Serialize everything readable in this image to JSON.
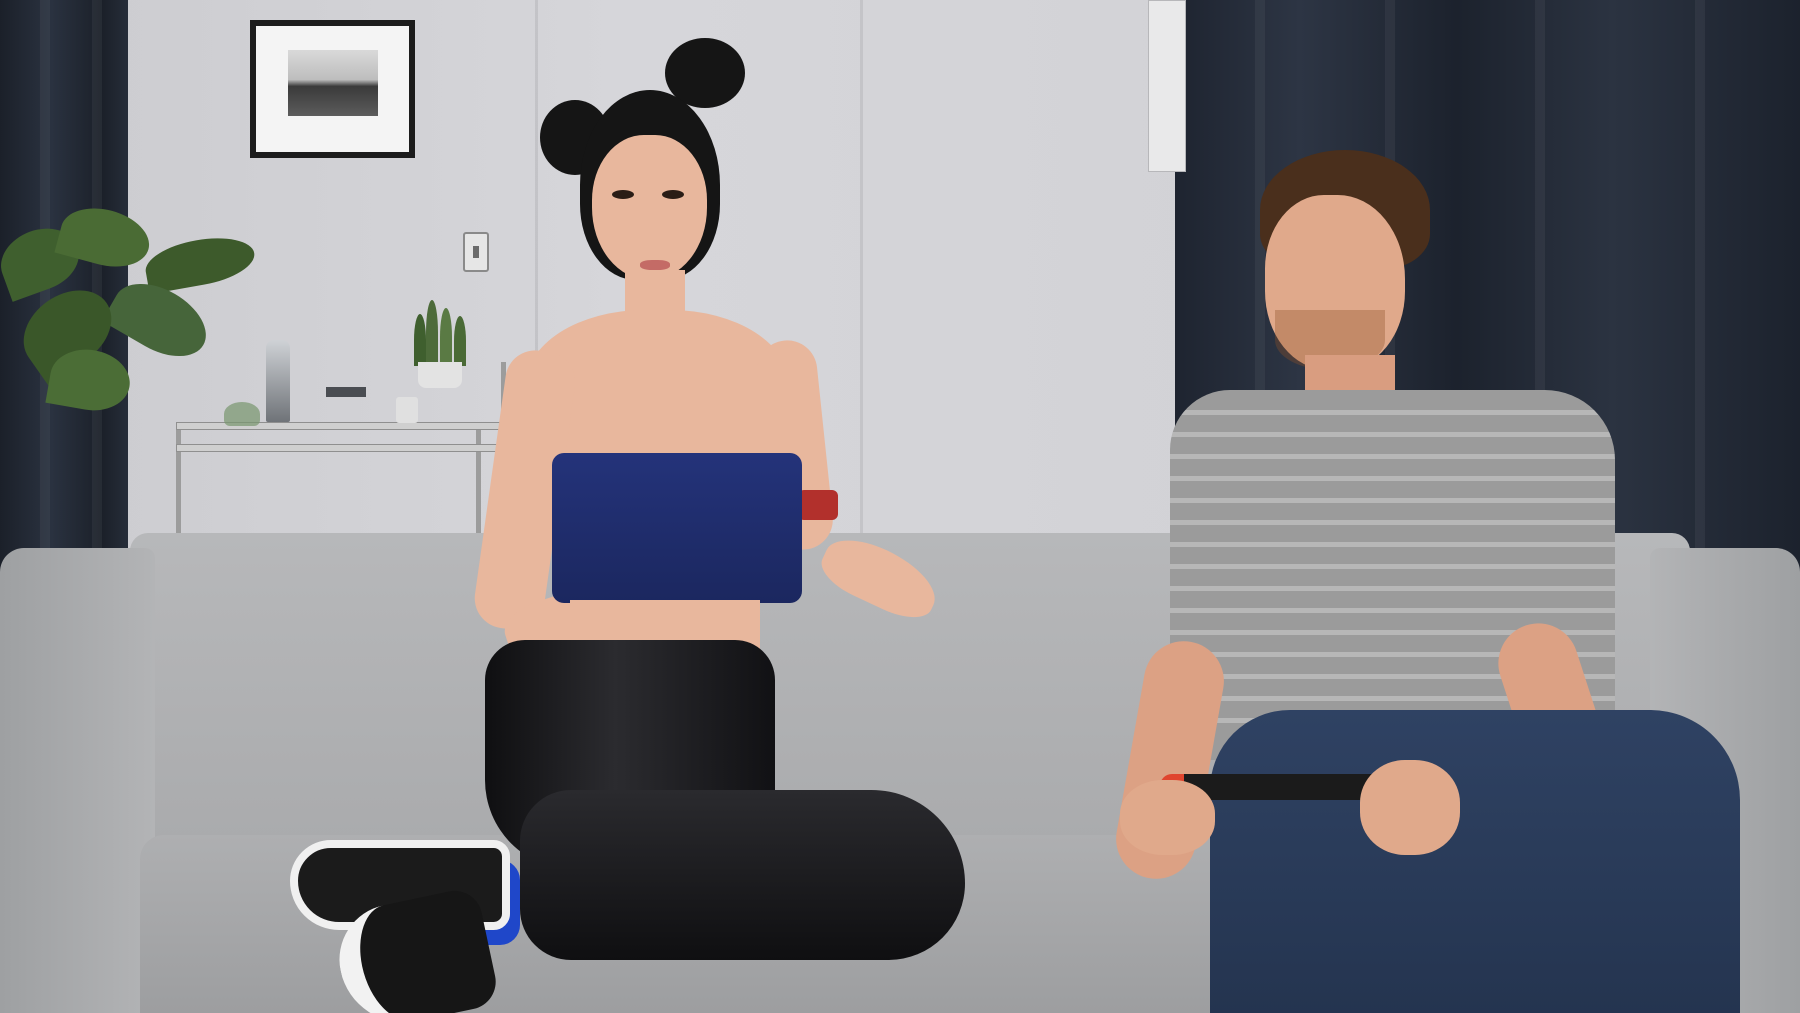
{
  "scene": {
    "description_elements": [
      "living-room-wall",
      "framed-photo",
      "light-switch",
      "potted-plant",
      "shelf-cart",
      "dark-curtains",
      "gray-couch",
      "woman-sitting",
      "man-sitting",
      "handheld-game-console"
    ]
  },
  "colors": {
    "wall": "#d3d3d7",
    "wall_shadow": "#bfc0c4",
    "curtain": "#1e2430",
    "couch": "#b5b6b8",
    "couch_dark": "#9c9d9f",
    "top_blue": "#1e2c6b",
    "pants_black": "#151517",
    "sock_blue": "#1f47c9",
    "shirt_gray": "#9b9b9b",
    "jeans": "#2a3b5a",
    "hair_dark": "#151515",
    "hair_brown": "#5a3a22",
    "controller_red": "#e0452f",
    "controller_blue": "#2a9bd8",
    "plant_green": "#3f5f2e"
  }
}
